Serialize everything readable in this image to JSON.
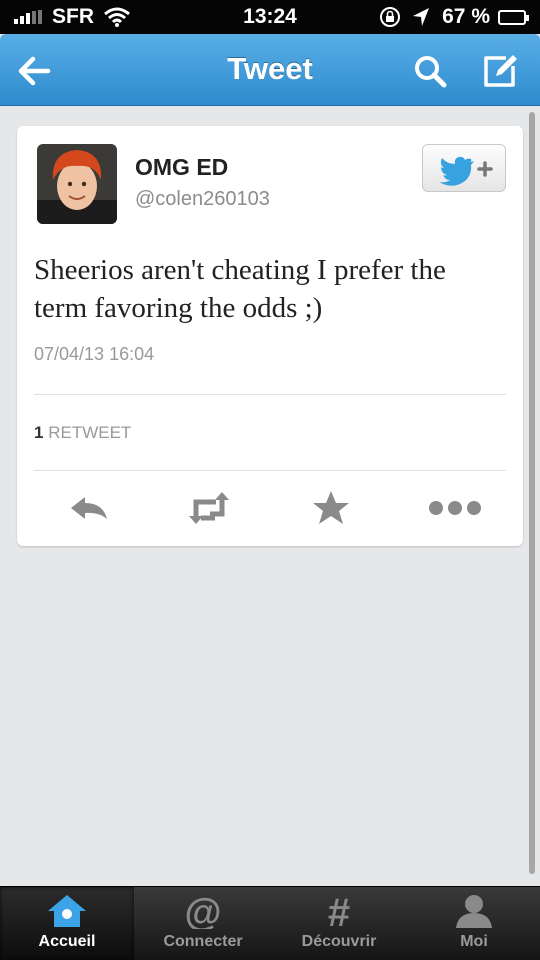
{
  "status_bar": {
    "carrier": "SFR",
    "time": "13:24",
    "battery": "67 %",
    "battery_level": 0.67,
    "icons": [
      "signal-icon",
      "wifi-icon",
      "rotation-lock-icon",
      "location-icon",
      "battery-icon"
    ]
  },
  "nav": {
    "title": "Tweet",
    "icons": [
      "back-arrow-icon",
      "search-icon",
      "compose-icon"
    ]
  },
  "tweet": {
    "name": "OMG ED",
    "handle": "@colen260103",
    "text": "Sheerios aren't cheating I prefer the term favoring the odds ;)",
    "timestamp": "07/04/13 16:04",
    "retweet_count": "1",
    "retweet_label": "RETWEET",
    "actions": [
      "reply-icon",
      "retweet-icon",
      "favorite-icon",
      "more-icon"
    ]
  },
  "tabs": [
    {
      "label": "Accueil",
      "icon": "home-icon",
      "active": true
    },
    {
      "label": "Connecter",
      "icon": "at-icon",
      "active": false
    },
    {
      "label": "Découvrir",
      "icon": "hashtag-icon",
      "active": false
    },
    {
      "label": "Moi",
      "icon": "person-icon",
      "active": false
    }
  ],
  "colors": {
    "nav_blue": "#3a96d8",
    "twitter_blue": "#55acee",
    "card_bg": "#ffffff",
    "page_bg": "#e6e7e9",
    "tabbar_bg": "#1e1e1e"
  }
}
